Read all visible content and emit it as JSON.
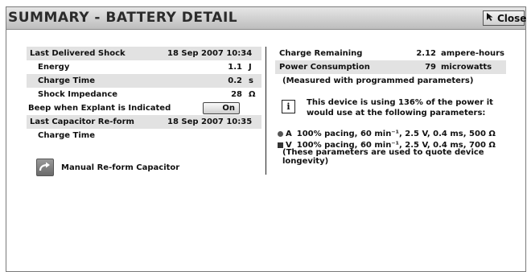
{
  "window": {
    "title": "SUMMARY - BATTERY DETAIL",
    "close_label": "Close"
  },
  "left": {
    "last_shock": {
      "label": "Last Delivered Shock",
      "date": "18 Sep 2007 10:34"
    },
    "energy": {
      "label": "Energy",
      "value": "1.1",
      "unit": "J"
    },
    "charge_time": {
      "label": "Charge Time",
      "value": "0.2",
      "unit": "s"
    },
    "impedance": {
      "label": "Shock Impedance",
      "value": "28",
      "unit": "Ω"
    },
    "beep": {
      "label": "Beep when Explant is Indicated",
      "toggle": "On"
    },
    "reform": {
      "label": "Last Capacitor Re-form",
      "date": "18 Sep 2007 10:35"
    },
    "reform_charge": {
      "label": "Charge Time"
    },
    "reform_button": {
      "label": "Manual Re-form Capacitor"
    }
  },
  "right": {
    "charge_remaining": {
      "label": "Charge Remaining",
      "value": "2.12",
      "unit": "ampere-hours"
    },
    "power": {
      "label": "Power Consumption",
      "value": "79",
      "unit": "microwatts"
    },
    "measured_note": "(Measured with programmed parameters)",
    "info_text": "This device is using 136% of the power it would use at the following parameters:",
    "param_a": {
      "letter": "A",
      "text": "100% pacing, 60 min⁻¹, 2.5 V, 0.4 ms, 500 Ω"
    },
    "param_v": {
      "letter": "V",
      "text": "100% pacing, 60 min⁻¹, 2.5 V, 0.4 ms, 700 Ω"
    },
    "longevity_note": "(These parameters are used to quote device longevity)"
  }
}
